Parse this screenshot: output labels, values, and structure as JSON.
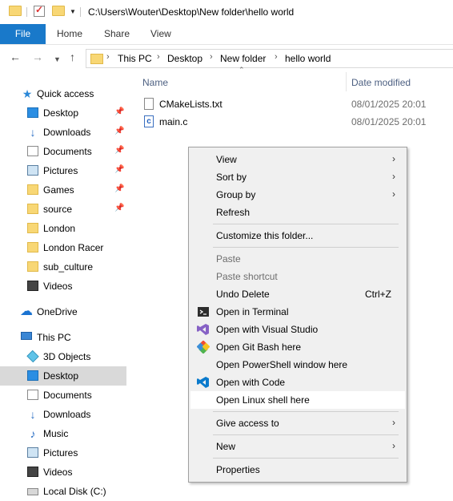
{
  "window": {
    "title": "C:\\Users\\Wouter\\Desktop\\New folder\\hello world"
  },
  "ribbon": {
    "tabs": [
      "File",
      "Home",
      "Share",
      "View"
    ]
  },
  "address": {
    "crumbs": [
      "This PC",
      "Desktop",
      "New folder",
      "hello world"
    ]
  },
  "sidebar": {
    "quick_access": "Quick access",
    "items": [
      {
        "label": "Desktop",
        "icon": "desktop-icon",
        "pinned": true
      },
      {
        "label": "Downloads",
        "icon": "downloads-icon",
        "pinned": true
      },
      {
        "label": "Documents",
        "icon": "documents-icon",
        "pinned": true
      },
      {
        "label": "Pictures",
        "icon": "pictures-icon",
        "pinned": true
      },
      {
        "label": "Games",
        "icon": "folder-icon",
        "pinned": true
      },
      {
        "label": "source",
        "icon": "folder-icon",
        "pinned": true
      },
      {
        "label": "London",
        "icon": "folder-icon",
        "pinned": false
      },
      {
        "label": "London Racer",
        "icon": "folder-icon",
        "pinned": false
      },
      {
        "label": "sub_culture",
        "icon": "folder-icon",
        "pinned": false
      },
      {
        "label": "Videos",
        "icon": "videos-icon",
        "pinned": false
      }
    ],
    "onedrive": "OneDrive",
    "this_pc": "This PC",
    "pc_items": [
      {
        "label": "3D Objects",
        "icon": "3d-objects-icon"
      },
      {
        "label": "Desktop",
        "icon": "desktop-icon",
        "selected": true
      },
      {
        "label": "Documents",
        "icon": "documents-icon"
      },
      {
        "label": "Downloads",
        "icon": "downloads-icon"
      },
      {
        "label": "Music",
        "icon": "music-icon"
      },
      {
        "label": "Pictures",
        "icon": "pictures-icon"
      },
      {
        "label": "Videos",
        "icon": "videos-icon"
      },
      {
        "label": "Local Disk (C:)",
        "icon": "local-disk-icon"
      }
    ]
  },
  "content": {
    "columns": {
      "name": "Name",
      "date": "Date modified"
    },
    "files": [
      {
        "name": "CMakeLists.txt",
        "date": "08/01/2025 20:01",
        "icon": "text-file-icon"
      },
      {
        "name": "main.c",
        "date": "08/01/2025 20:01",
        "icon": "c-file-icon"
      }
    ]
  },
  "context_menu": {
    "groups": [
      [
        {
          "label": "View",
          "submenu": true
        },
        {
          "label": "Sort by",
          "submenu": true
        },
        {
          "label": "Group by",
          "submenu": true
        },
        {
          "label": "Refresh"
        }
      ],
      [
        {
          "label": "Customize this folder..."
        }
      ],
      [
        {
          "label": "Paste",
          "disabled": true
        },
        {
          "label": "Paste shortcut",
          "disabled": true
        },
        {
          "label": "Undo Delete",
          "shortcut": "Ctrl+Z"
        },
        {
          "label": "Open in Terminal",
          "icon": "terminal-icon"
        },
        {
          "label": "Open with Visual Studio",
          "icon": "visual-studio-icon"
        },
        {
          "label": "Open Git Bash here",
          "icon": "git-bash-icon"
        },
        {
          "label": "Open PowerShell window here"
        },
        {
          "label": "Open with Code",
          "icon": "vscode-icon"
        },
        {
          "label": "Open Linux shell here",
          "hover": true
        }
      ],
      [
        {
          "label": "Give access to",
          "submenu": true
        }
      ],
      [
        {
          "label": "New",
          "submenu": true
        }
      ],
      [
        {
          "label": "Properties"
        }
      ]
    ]
  },
  "colors": {
    "accent": "#1979ca",
    "selected_bg": "#d9d9d9",
    "menu_bg": "#f0f0f0"
  }
}
